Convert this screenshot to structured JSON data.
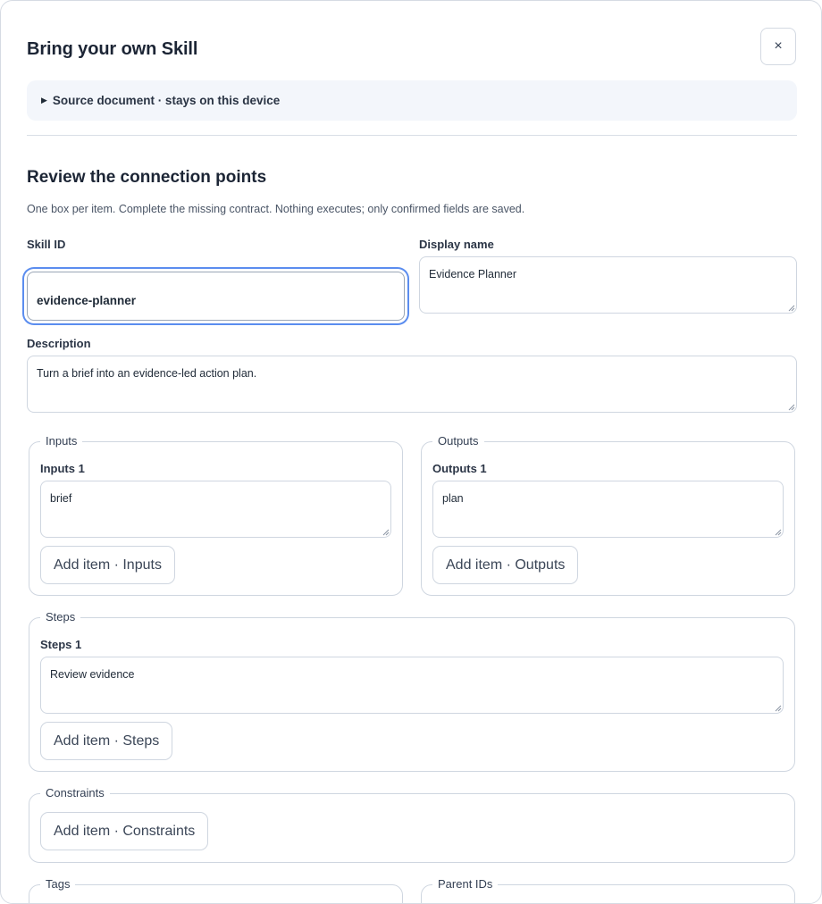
{
  "modal": {
    "title": "Bring your own Skill",
    "close_label": "×",
    "source_toggle": "Source document · stays on this device"
  },
  "review": {
    "title": "Review the connection points",
    "helper": "One box per item. Complete the missing contract. Nothing executes; only confirmed fields are saved."
  },
  "fields": {
    "skill_id": {
      "label": "Skill ID",
      "value": "evidence-planner"
    },
    "display_name": {
      "label": "Display name",
      "value": "Evidence Planner"
    },
    "description": {
      "label": "Description",
      "value": "Turn a brief into an evidence-led action plan."
    }
  },
  "groups": {
    "inputs": {
      "legend": "Inputs",
      "item_label": "Inputs 1",
      "item_value": "brief",
      "add_label": "Add item · Inputs"
    },
    "outputs": {
      "legend": "Outputs",
      "item_label": "Outputs 1",
      "item_value": "plan",
      "add_label": "Add item · Outputs"
    },
    "steps": {
      "legend": "Steps",
      "item_label": "Steps 1",
      "item_value": "Review evidence",
      "add_label": "Add item · Steps"
    },
    "constraints": {
      "legend": "Constraints",
      "add_label": "Add item · Constraints"
    },
    "tags": {
      "legend": "Tags"
    },
    "parent_ids": {
      "legend": "Parent IDs"
    }
  },
  "colors": {
    "focus_ring": "#5b8def",
    "border": "#cfd6e0",
    "source_bg": "#f3f6fb",
    "text": "#1f2a37"
  },
  "icons": {
    "close": "close-icon",
    "disclosure": "triangle-right-icon",
    "resize": "resize-grip-icon"
  }
}
